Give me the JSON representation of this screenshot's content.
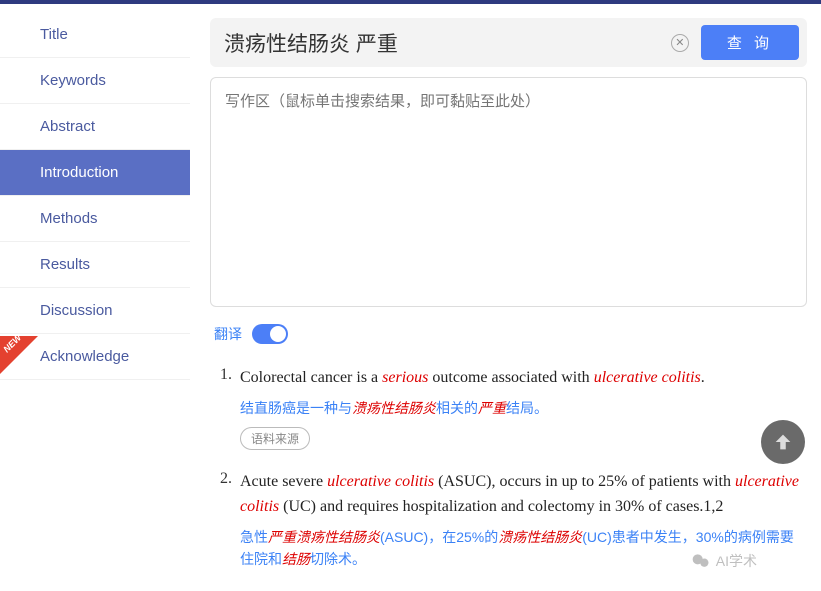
{
  "sidebar": {
    "items": [
      {
        "label": "Title"
      },
      {
        "label": "Keywords"
      },
      {
        "label": "Abstract"
      },
      {
        "label": "Introduction"
      },
      {
        "label": "Methods"
      },
      {
        "label": "Results"
      },
      {
        "label": "Discussion"
      },
      {
        "label": "Acknowledge"
      }
    ],
    "active_index": 3,
    "new_badge": "NEW"
  },
  "search": {
    "value": "溃疡性结肠炎 严重",
    "query_button": "查 询"
  },
  "textarea": {
    "placeholder": "写作区（鼠标单击搜索结果，即可黏贴至此处）"
  },
  "translate": {
    "label": "翻译",
    "enabled": true
  },
  "source_button": "语料来源",
  "results": [
    {
      "num": "1.",
      "en_parts": [
        "Colorectal cancer is a ",
        "serious",
        " outcome associated with ",
        "ulcerative colitis",
        "."
      ],
      "en_hl": [
        false,
        true,
        false,
        true,
        false
      ],
      "cn_parts": [
        "结直肠癌是一种与",
        "溃疡性结肠炎",
        "相关的",
        "严重",
        "结局。"
      ],
      "cn_hl": [
        false,
        true,
        false,
        true,
        false
      ],
      "show_source": true
    },
    {
      "num": "2.",
      "en_parts": [
        "Acute severe ",
        "ulcerative colitis",
        " (ASUC), occurs in up to 25% of patients with ",
        "ulcerative colitis",
        " (UC) and requires hospitalization and colectomy in 30% of cases.1,2"
      ],
      "en_hl": [
        false,
        true,
        false,
        true,
        false
      ],
      "cn_parts": [
        "急性",
        "严重溃疡性结肠炎",
        "(ASUC)，在25%的",
        "溃疡性结肠炎",
        "(UC)患者中发生，30%的病例需要住院和",
        "结肠",
        "切除术。"
      ],
      "cn_hl": [
        false,
        true,
        false,
        true,
        false,
        true,
        false
      ],
      "show_source": false
    }
  ],
  "watermark": "AI学术"
}
